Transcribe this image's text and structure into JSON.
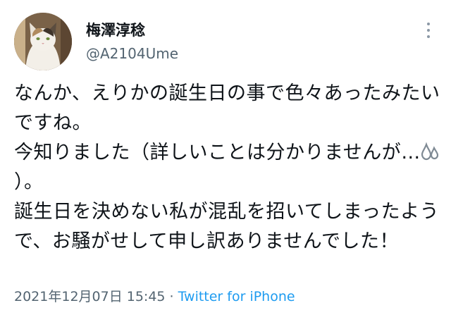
{
  "tweet": {
    "display_name": "梅澤淳稔",
    "handle": "@A2104Ume",
    "text_before_emoji": "なんか、えりかの誕生日の事で色々あったみたいですね。\n今知りました（詳しいことは分かりませんが…",
    "emoji": "sweat-drops-icon",
    "text_after_emoji": "）。\n誕生日を決めない私が混乱を招いてしまったようで、お騒がせして申し訳ありませんでした！",
    "timestamp": "2021年12月07日 15:45",
    "separator": "·",
    "source": "Twitter for iPhone"
  },
  "colors": {
    "text": "#0f1419",
    "secondary": "#536471",
    "link": "#1d9bf0"
  }
}
